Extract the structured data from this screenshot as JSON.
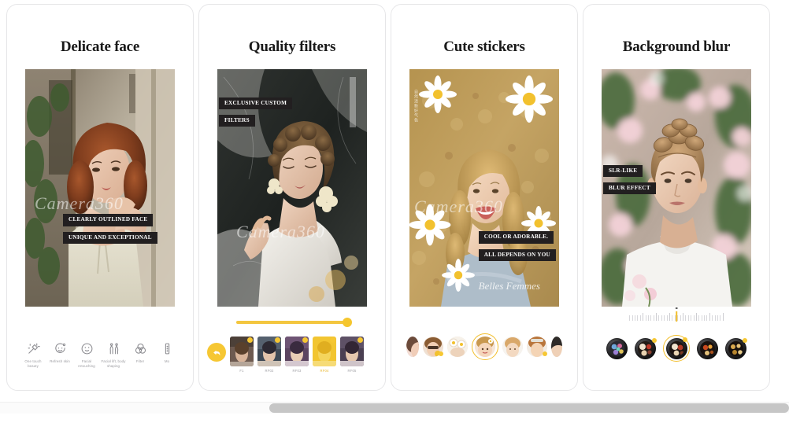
{
  "page": {
    "background": "#ffffff",
    "accent": "#F5C62E",
    "badge_bg": "#221f20",
    "card_border": "#e6e6e8"
  },
  "cards": [
    {
      "title": "Delicate face",
      "badges": [
        "CLEARLY OUTLINED FACE",
        "UNIQUE AND EXCEPTIONAL"
      ],
      "watermark": "Camera360",
      "toolbar": [
        {
          "icon": "magic-wand-icon",
          "label": "One touch\nbeauty"
        },
        {
          "icon": "smiley-face-icon",
          "label": "Refresh skin"
        },
        {
          "icon": "face-circle-icon",
          "label": "Facial\nretouching"
        },
        {
          "icon": "body-shape-icon",
          "label": "Facial lift,\nbody shaping"
        },
        {
          "icon": "filter-circles-icon",
          "label": "Filter"
        },
        {
          "icon": "more-icon",
          "label": "Mo"
        }
      ]
    },
    {
      "title": "Quality filters",
      "badges": [
        "EXCLUSIVE CUSTOM",
        "FILTERS"
      ],
      "watermark": "Camera360",
      "slider": {
        "value": 100,
        "color": "#F5C62E"
      },
      "undo_label": "undo",
      "filters": [
        {
          "label": "F1",
          "selected": false
        },
        {
          "label": "RF02",
          "selected": false
        },
        {
          "label": "RF03",
          "selected": false
        },
        {
          "label": "RF04",
          "selected": true
        },
        {
          "label": "RF05",
          "selected": false
        }
      ]
    },
    {
      "title": "Cute stickers",
      "badges": [
        "COOL OR ADORABLE.",
        "ALL DEPENDS ON YOU"
      ],
      "watermark": "Camera360",
      "signature": "Belles Femmes",
      "stickers": [
        {
          "name": "sticker-1",
          "selected": false
        },
        {
          "name": "sticker-2",
          "selected": false
        },
        {
          "name": "sticker-3",
          "selected": false
        },
        {
          "name": "sticker-4",
          "selected": true
        },
        {
          "name": "sticker-5",
          "selected": false
        },
        {
          "name": "sticker-6",
          "selected": false
        },
        {
          "name": "sticker-7",
          "selected": false
        }
      ]
    },
    {
      "title": "Background  blur",
      "badges": [
        "SLR-LIKE",
        "BLUR EFFECT"
      ],
      "ruler": {
        "position": 50
      },
      "lenses": [
        {
          "name": "lens-1",
          "selected": false,
          "badge": false
        },
        {
          "name": "lens-2",
          "selected": false,
          "badge": true
        },
        {
          "name": "lens-3",
          "selected": true,
          "badge": true
        },
        {
          "name": "lens-4",
          "selected": false,
          "badge": false
        },
        {
          "name": "lens-5",
          "selected": false,
          "badge": true
        }
      ]
    }
  ],
  "scrollbar": {
    "thumb_color": "#c6c6c6",
    "track_color": "#fbfbfb"
  }
}
